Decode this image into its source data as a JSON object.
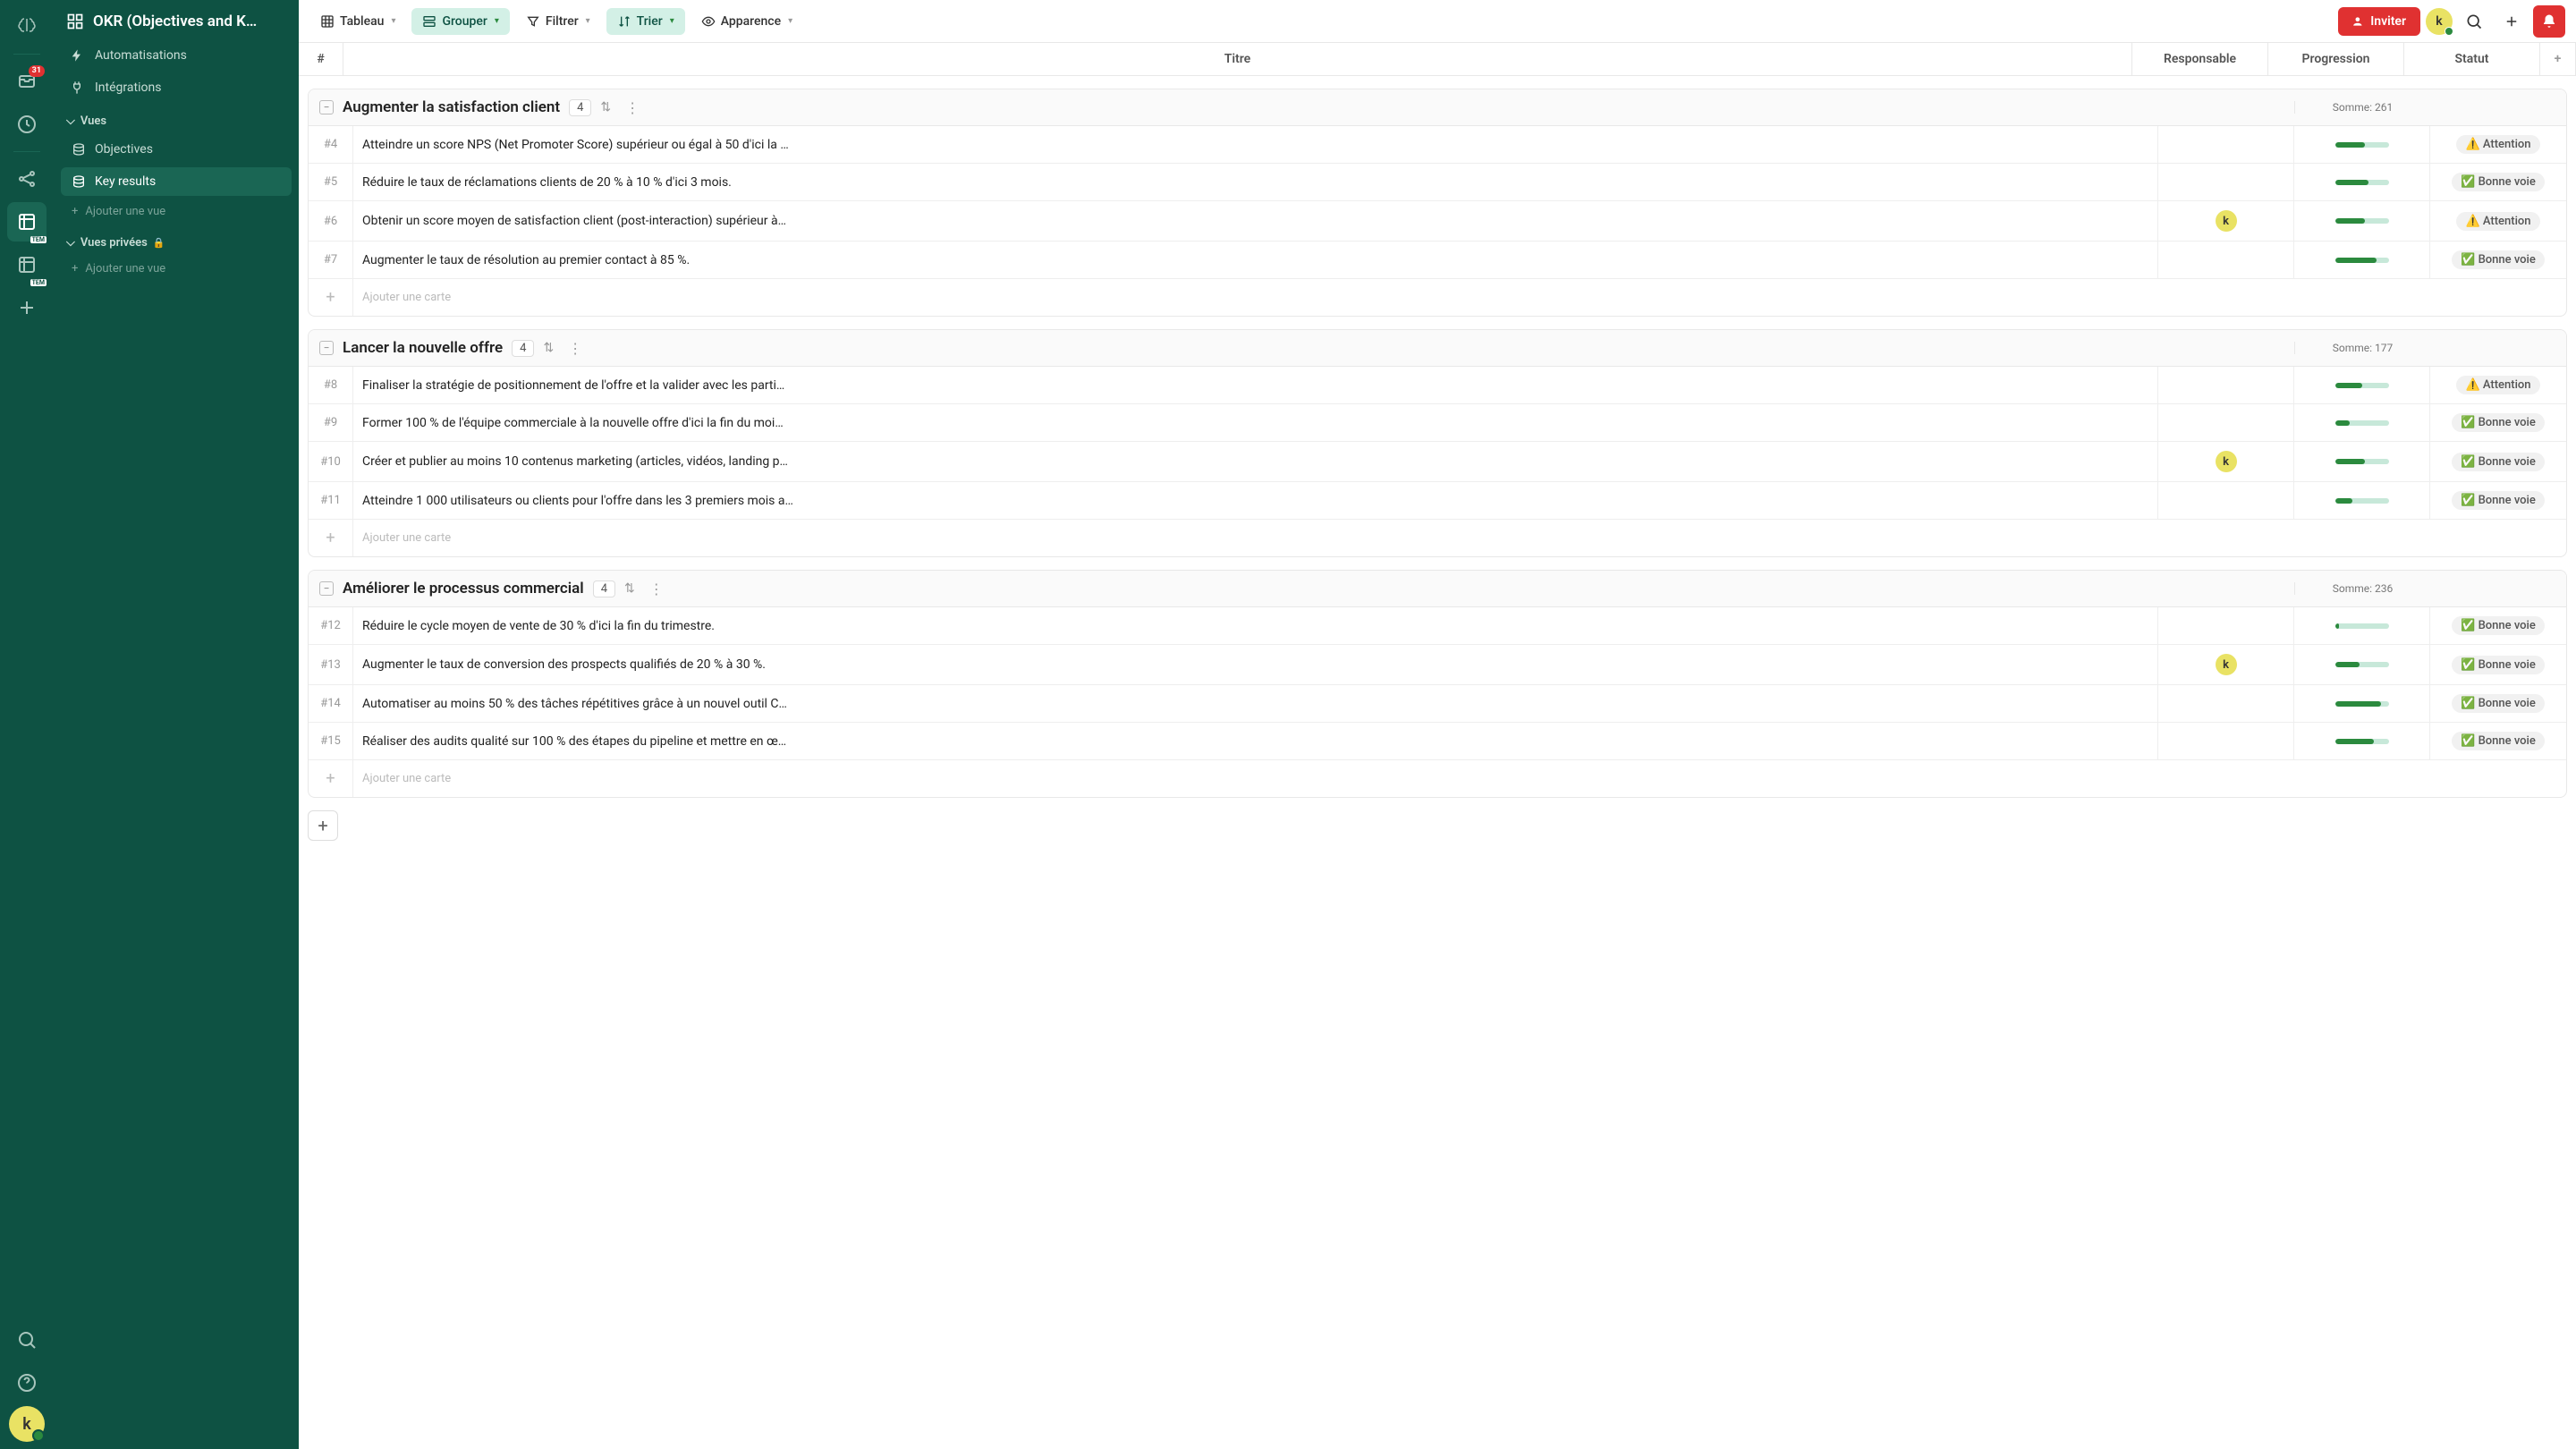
{
  "rail": {
    "inbox_badge": "31",
    "tem_label": "TEM"
  },
  "sidebar": {
    "title": "OKR (Objectives and K…",
    "nav": [
      {
        "label": "Automatisations"
      },
      {
        "label": "Intégrations"
      }
    ],
    "vues_label": "Vues",
    "views": [
      {
        "label": "Objectives"
      },
      {
        "label": "Key results"
      }
    ],
    "add_view": "Ajouter une vue",
    "private_label": "Vues privées"
  },
  "topbar": {
    "tableau": "Tableau",
    "grouper": "Grouper",
    "filtrer": "Filtrer",
    "trier": "Trier",
    "apparence": "Apparence",
    "inviter": "Inviter",
    "avatar": "k"
  },
  "columns": {
    "num": "#",
    "titre": "Titre",
    "responsable": "Responsable",
    "progression": "Progression",
    "statut": "Statut"
  },
  "status_labels": {
    "attention": "Attention",
    "bonne": "Bonne voie"
  },
  "add_card": "Ajouter une carte",
  "groups": [
    {
      "title": "Augmenter la satisfaction client",
      "count": "4",
      "sum": "Somme: 261",
      "rows": [
        {
          "num": "#4",
          "title": "Atteindre un score NPS (Net Promoter Score) supérieur ou égal à 50 d'ici la …",
          "resp": "",
          "prog": 55,
          "status": "attention"
        },
        {
          "num": "#5",
          "title": "Réduire le taux de réclamations clients de 20 % à 10 % d'ici 3 mois.",
          "resp": "",
          "prog": 62,
          "status": "bonne"
        },
        {
          "num": "#6",
          "title": "Obtenir un score moyen de satisfaction client (post-interaction) supérieur à…",
          "resp": "k",
          "prog": 55,
          "status": "attention"
        },
        {
          "num": "#7",
          "title": "Augmenter le taux de résolution au premier contact à 85 %.",
          "resp": "",
          "prog": 78,
          "status": "bonne"
        }
      ]
    },
    {
      "title": "Lancer la nouvelle offre",
      "count": "4",
      "sum": "Somme: 177",
      "rows": [
        {
          "num": "#8",
          "title": "Finaliser la stratégie de positionnement de l'offre et la valider avec les parti…",
          "resp": "",
          "prog": 50,
          "status": "attention"
        },
        {
          "num": "#9",
          "title": "Former 100 % de l'équipe commerciale à la nouvelle offre d'ici la fin du moi…",
          "resp": "",
          "prog": 28,
          "status": "bonne"
        },
        {
          "num": "#10",
          "title": "Créer et publier au moins 10 contenus marketing (articles, vidéos, landing p…",
          "resp": "k",
          "prog": 55,
          "status": "bonne"
        },
        {
          "num": "#11",
          "title": "Atteindre 1 000 utilisateurs ou clients pour l'offre dans les 3 premiers mois a…",
          "resp": "",
          "prog": 32,
          "status": "bonne"
        }
      ]
    },
    {
      "title": "Améliorer le processus commercial",
      "count": "4",
      "sum": "Somme: 236",
      "rows": [
        {
          "num": "#12",
          "title": "Réduire le cycle moyen de vente de 30 % d'ici la fin du trimestre.",
          "resp": "",
          "prog": 8,
          "status": "bonne"
        },
        {
          "num": "#13",
          "title": "Augmenter le taux de conversion des prospects qualifiés de 20 % à 30 %.",
          "resp": "k",
          "prog": 45,
          "status": "bonne"
        },
        {
          "num": "#14",
          "title": "Automatiser au moins 50 % des tâches répétitives grâce à un nouvel outil C…",
          "resp": "",
          "prog": 85,
          "status": "bonne"
        },
        {
          "num": "#15",
          "title": "Réaliser des audits qualité sur 100 % des étapes du pipeline et mettre en œ…",
          "resp": "",
          "prog": 72,
          "status": "bonne"
        }
      ]
    }
  ]
}
